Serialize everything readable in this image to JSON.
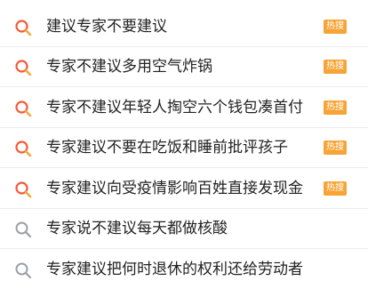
{
  "colors": {
    "hot_icon_ring": "#f45b3a",
    "hot_icon_tail": "#f7a436",
    "normal_icon": "#9aa0a6",
    "badge_bg": "#f7a436",
    "text": "#222222"
  },
  "suggestions": [
    {
      "text": "建议专家不要建议",
      "hot": true,
      "badge": "热搜",
      "icon": "hot-search-icon"
    },
    {
      "text": "专家不建议多用空气炸锅",
      "hot": true,
      "badge": "热搜",
      "icon": "hot-search-icon"
    },
    {
      "text": "专家不建议年轻人掏空六个钱包凑首付",
      "hot": true,
      "badge": "热搜",
      "icon": "hot-search-icon"
    },
    {
      "text": "专家建议不要在吃饭和睡前批评孩子",
      "hot": true,
      "badge": "热搜",
      "icon": "hot-search-icon"
    },
    {
      "text": "专家建议向受疫情影响百姓直接发现金",
      "hot": true,
      "badge": "热搜",
      "icon": "hot-search-icon"
    },
    {
      "text": "专家说不建议每天都做核酸",
      "hot": false,
      "icon": "search-icon"
    },
    {
      "text": "专家建议把何时退休的权利还给劳动者",
      "hot": false,
      "icon": "search-icon"
    }
  ]
}
